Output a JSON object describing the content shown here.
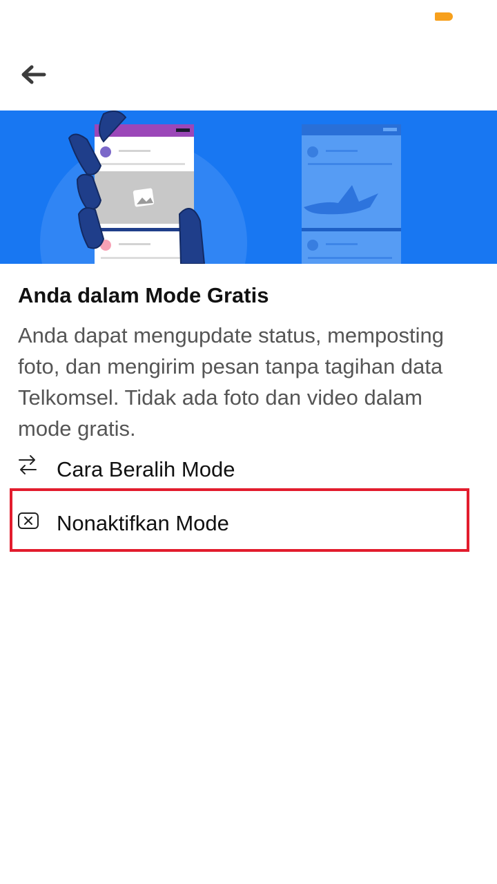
{
  "colors": {
    "accent": "#1877f2",
    "battery": "#f7a01c",
    "highlight_border": "#e21c2d",
    "title": "#111111",
    "body_text": "#555555"
  },
  "status_bar": {
    "battery_icon": "battery-icon"
  },
  "header": {
    "back_icon": "arrow-left-icon"
  },
  "hero": {
    "illustration": "hand-holding-phone-illustration"
  },
  "content": {
    "title": "Anda dalam Mode Gratis",
    "description": "Anda dapat mengupdate status, memposting foto, dan mengirim pesan tanpa tagihan data Telkomsel. Tidak ada foto dan video dalam mode gratis."
  },
  "options": [
    {
      "icon": "swap-arrows-icon",
      "label": "Cara Beralih Mode"
    },
    {
      "icon": "close-box-icon",
      "label": "Nonaktifkan Mode"
    }
  ]
}
